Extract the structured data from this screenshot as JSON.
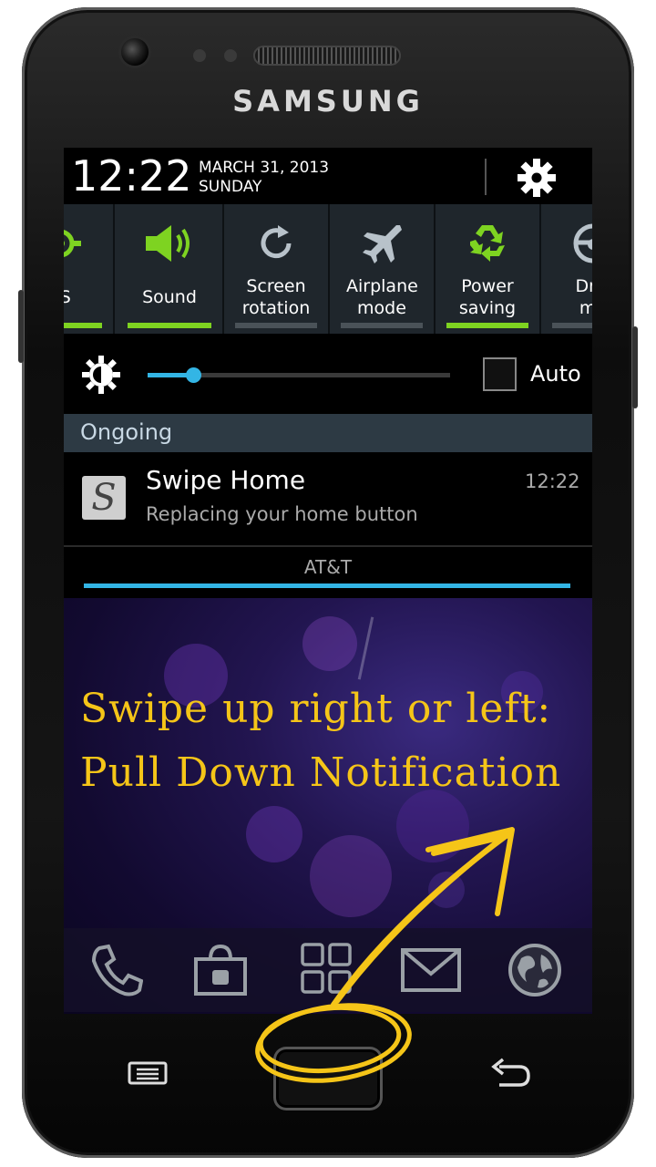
{
  "device": {
    "brand": "SAMSUNG"
  },
  "statusbar": {
    "time": "12:22",
    "date": "MARCH 31, 2013",
    "day": "SUNDAY"
  },
  "toggles": [
    {
      "label": "PS",
      "icon": "gps-icon",
      "active": true
    },
    {
      "label": "Sound",
      "icon": "speaker-icon",
      "active": true
    },
    {
      "label": "Screen rotation",
      "icon": "rotation-icon",
      "active": false
    },
    {
      "label": "Airplane mode",
      "icon": "airplane-icon",
      "active": false
    },
    {
      "label": "Power saving",
      "icon": "recycle-icon",
      "active": true
    },
    {
      "label": "Driv mo",
      "icon": "steering-icon",
      "active": false
    }
  ],
  "brightness": {
    "level": 0.15,
    "auto_label": "Auto",
    "auto_checked": false
  },
  "ongoing": {
    "header": "Ongoing"
  },
  "notification": {
    "title": "Swipe Home",
    "subtitle": "Replacing your home button",
    "time": "12:22",
    "app_icon_letter": "S"
  },
  "carrier": "AT&T",
  "instruction": {
    "line1": "Swipe up right or left:",
    "line2": "Pull Down Notification"
  },
  "dock": [
    {
      "icon": "phone-icon"
    },
    {
      "icon": "play-store-icon"
    },
    {
      "icon": "apps-grid-icon"
    },
    {
      "icon": "email-icon"
    },
    {
      "icon": "globe-icon"
    }
  ],
  "colors": {
    "accent_blue": "#33b5e5",
    "toggle_on": "#7ed321",
    "instruction": "#f5c518"
  }
}
